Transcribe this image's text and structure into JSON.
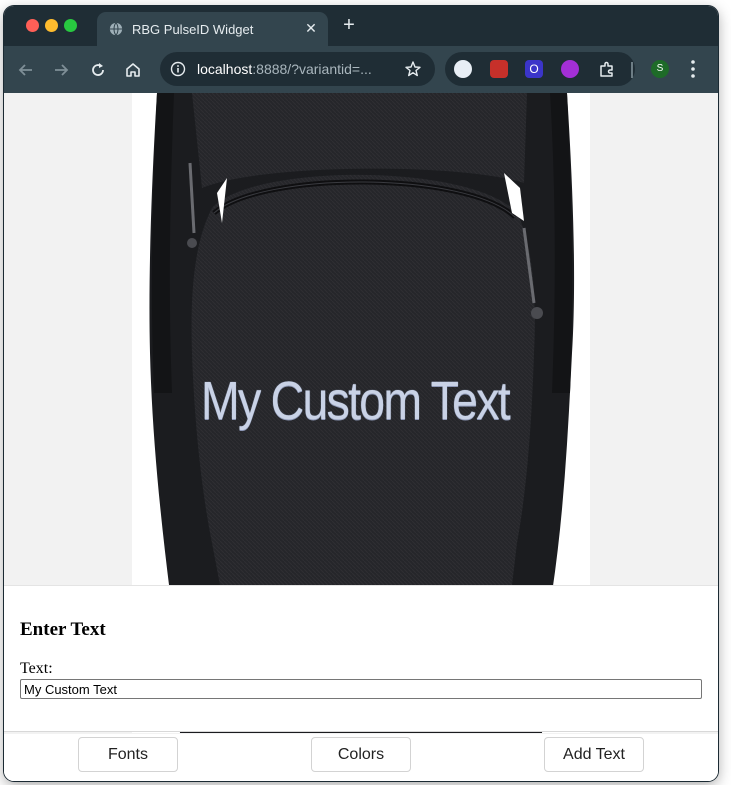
{
  "browser": {
    "tab": {
      "title": "RBG PulseID Widget",
      "favicon": "globe-icon",
      "close_icon": "close-icon"
    },
    "toolbar": {
      "back_icon": "arrow-left-icon",
      "forward_icon": "arrow-right-icon",
      "reload_icon": "reload-icon",
      "home_icon": "home-icon",
      "url_host": "localhost",
      "url_rest": ":8888/?variantid=...",
      "bookmark_icon": "star-icon",
      "profile_initial": "S"
    },
    "extensions": [
      "password-manager-icon",
      "book-icon",
      "o-icon",
      "scan-icon",
      "puzzle-icon"
    ]
  },
  "product": {
    "preview_text": "My Custom Text"
  },
  "panel": {
    "title": "Enter Text",
    "text_label": "Text:",
    "text_value": "My Custom Text"
  },
  "actions": {
    "fonts_label": "Fonts",
    "colors_label": "Colors",
    "add_text_label": "Add Text"
  },
  "colors": {
    "tab_strip": "#1f2d35",
    "toolbar": "#33454e",
    "page_bg": "#f2f2f2",
    "bag": "#222326",
    "embroidery": "#c9d2e6"
  }
}
